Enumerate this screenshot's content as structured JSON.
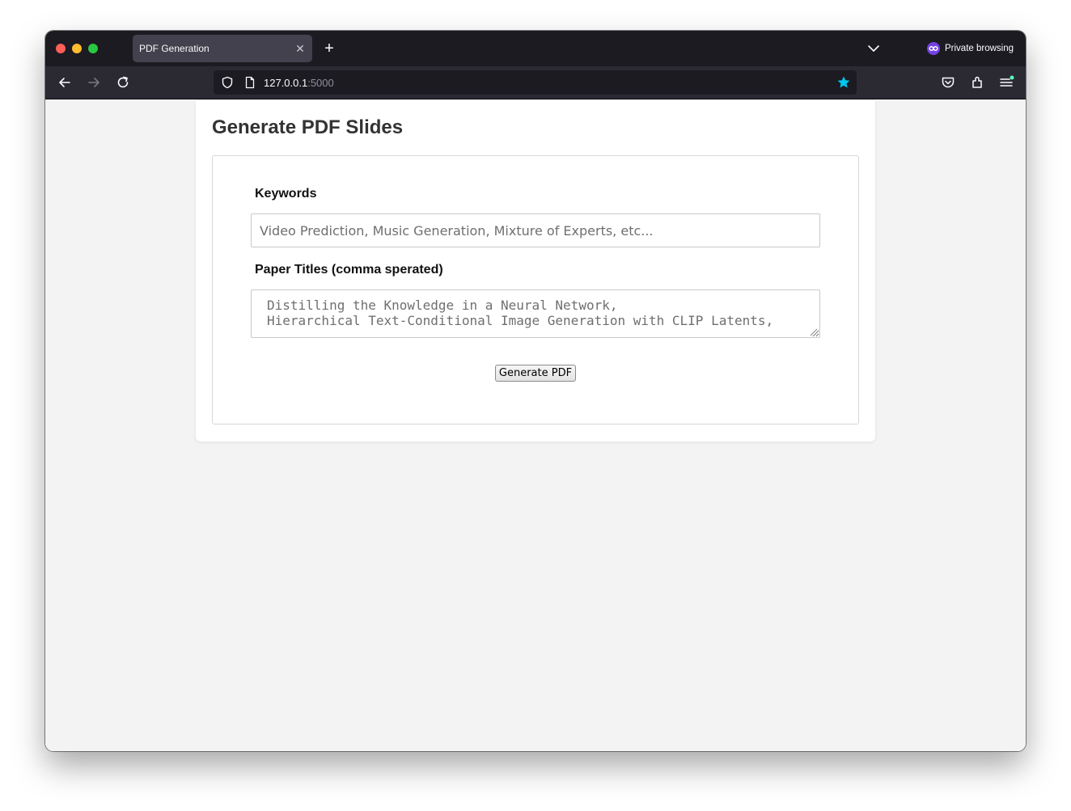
{
  "browser": {
    "tab_title": "PDF Generation",
    "tab_close_glyph": "✕",
    "new_tab_glyph": "+",
    "private_label": "Private browsing",
    "url_host": "127.0.0.1",
    "url_port": ":5000",
    "bookmark_star_color": "#00c8f0",
    "icons": [
      "back-icon",
      "forward-icon",
      "reload-icon",
      "shield-icon",
      "page-icon",
      "star-icon",
      "pocket-icon",
      "extensions-icon",
      "menu-icon",
      "tab-list-icon",
      "private-mask-icon"
    ]
  },
  "page": {
    "title": "Generate PDF Slides",
    "keywords_label": "Keywords",
    "keywords_placeholder": "Video Prediction, Music Generation, Mixture of Experts, etc...",
    "titles_label": "Paper Titles (comma sperated)",
    "titles_placeholder": "Distilling the Knowledge in a Neural Network,\nHierarchical Text-Conditional Image Generation with CLIP Latents,",
    "submit_label": "Generate PDF"
  }
}
